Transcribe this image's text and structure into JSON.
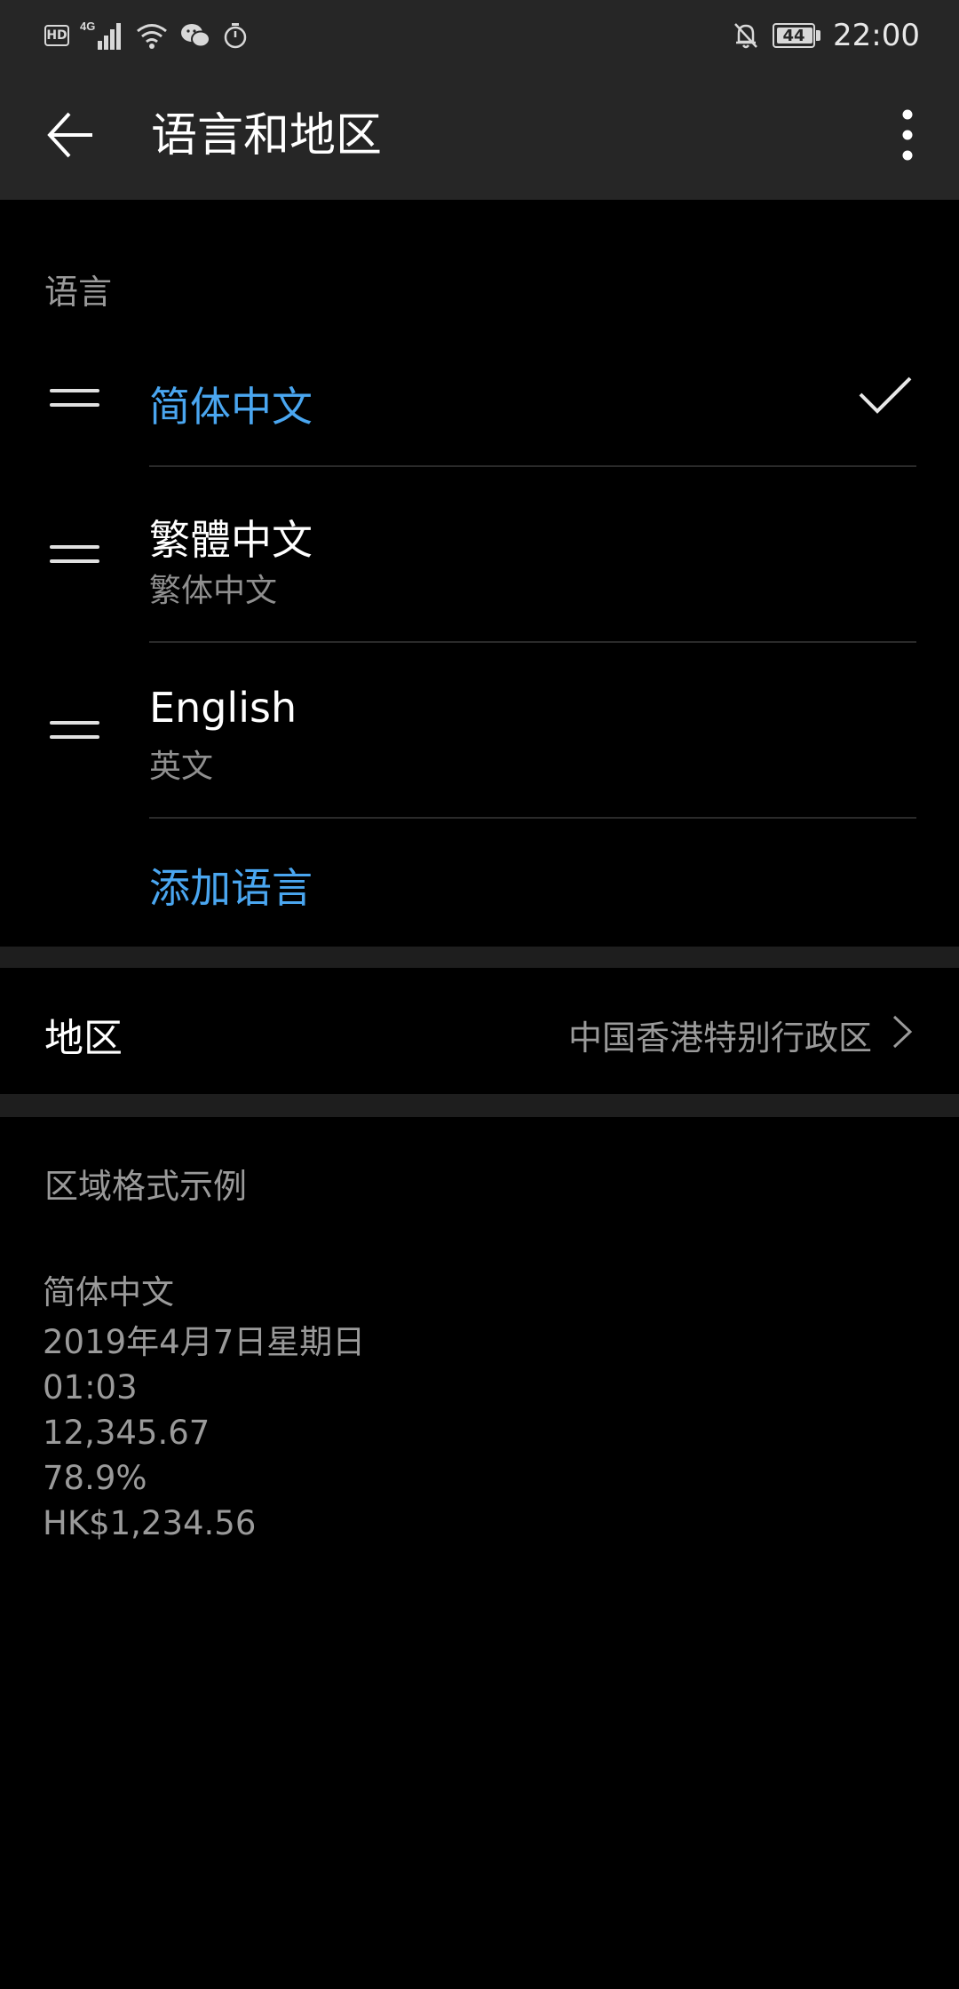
{
  "status_bar": {
    "hd_label": "HD",
    "network_label": "4G",
    "battery_level": "44",
    "time": "22:00",
    "icons": [
      "hd-icon",
      "signal-icon",
      "wifi-icon",
      "wechat-icon",
      "stopwatch-icon",
      "mute-bell-icon",
      "battery-icon"
    ]
  },
  "toolbar": {
    "title": "语言和地区",
    "back_icon": "arrow-left-icon",
    "more_icon": "more-vertical-icon"
  },
  "language_section": {
    "label": "语言",
    "languages": [
      {
        "name": "简体中文",
        "subtitle": "",
        "selected": true
      },
      {
        "name": "繁體中文",
        "subtitle": "繁体中文",
        "selected": false
      },
      {
        "name": "English",
        "subtitle": "英文",
        "selected": false
      }
    ],
    "add_language": "添加语言"
  },
  "region": {
    "label": "地区",
    "value": "中国香港特别行政区"
  },
  "format_example": {
    "title": "区域格式示例",
    "lines": [
      "简体中文",
      "2019年4月7日星期日",
      "01:03",
      "12,345.67",
      "78.9%",
      "HK$1,234.56"
    ]
  },
  "colors": {
    "accent": "#4aa6f0",
    "toolbar_bg": "#262626",
    "background": "#000000",
    "secondary_text": "#9a9a9a"
  }
}
